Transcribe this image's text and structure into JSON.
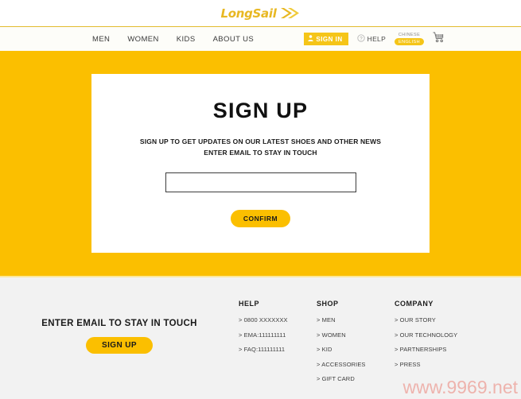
{
  "brand": {
    "name": "LongSail",
    "logo_color": "#e8b823",
    "accent_color": "#fbbf00",
    "hero_color": "#fbbf00",
    "footer_bg": "#f2f2f2"
  },
  "nav": {
    "items": [
      {
        "label": "MEN"
      },
      {
        "label": "WOMEN"
      },
      {
        "label": "KIDS"
      },
      {
        "label": "ABOUT US"
      }
    ],
    "sign_in_label": "SIGN IN",
    "sign_in_icon": "user-icon",
    "help_label": "HELP",
    "help_icon": "question-circle-icon",
    "lang_inactive": "CHINESE",
    "lang_active": "ENGLISH",
    "cart_icon": "shopping-cart-icon"
  },
  "hero": {
    "title": "SIGN UP",
    "subtitle_line1": "SIGN UP TO GET UPDATES ON OUR LATEST SHOES AND OTHER NEWS",
    "subtitle_line2": "ENTER EMAIL TO STAY IN TOUCH",
    "email_value": "",
    "email_placeholder": "",
    "confirm_label": "CONFIRM"
  },
  "footer": {
    "cta_text": "ENTER EMAIL TO STAY IN TOUCH",
    "signup_label": "SIGN UP",
    "columns": [
      {
        "title": "HELP",
        "links": [
          "> 0800 XXXXXXX",
          "> EMA:111111111",
          "> FAQ:111111111"
        ]
      },
      {
        "title": "SHOP",
        "links": [
          "> MEN",
          "> WOMEN",
          "> KID",
          "> ACCESSORIES",
          "> GIFT CARD"
        ]
      },
      {
        "title": "COMPANY",
        "links": [
          "> OUR STORY",
          "> OUR TECHNOLOGY",
          "> PARTNERSHIPS",
          "> PRESS"
        ]
      }
    ],
    "watermark": "www.9969.net"
  }
}
